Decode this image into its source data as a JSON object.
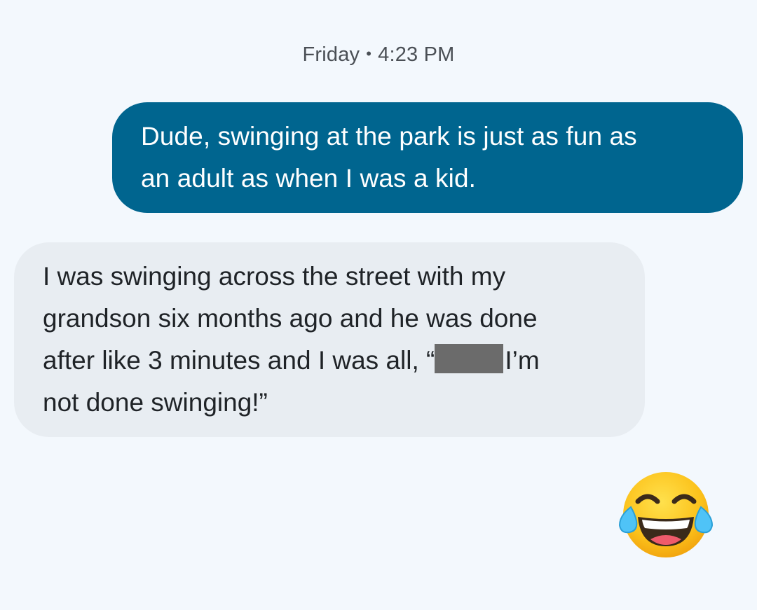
{
  "conversation": {
    "timestamp": {
      "day": "Friday",
      "separator": "•",
      "time": "4:23 PM"
    },
    "messages": [
      {
        "direction": "sent",
        "lines": [
          "Dude, swinging at the park is just as fun as",
          "an adult as when I was a  kid."
        ]
      },
      {
        "direction": "received",
        "lines": [
          "I was swinging across the street with my",
          "grandson six months ago and he was done",
          "after like 3 minutes and I was all, “",
          "I’m",
          "not done swinging!”"
        ]
      }
    ],
    "reaction": {
      "icon": "face-with-tears-of-joy-icon"
    }
  },
  "colors": {
    "background": "#f3f8fd",
    "sent_bubble": "#00658f",
    "received_bubble": "#e8edf2",
    "redaction": "#6b6b6b"
  }
}
